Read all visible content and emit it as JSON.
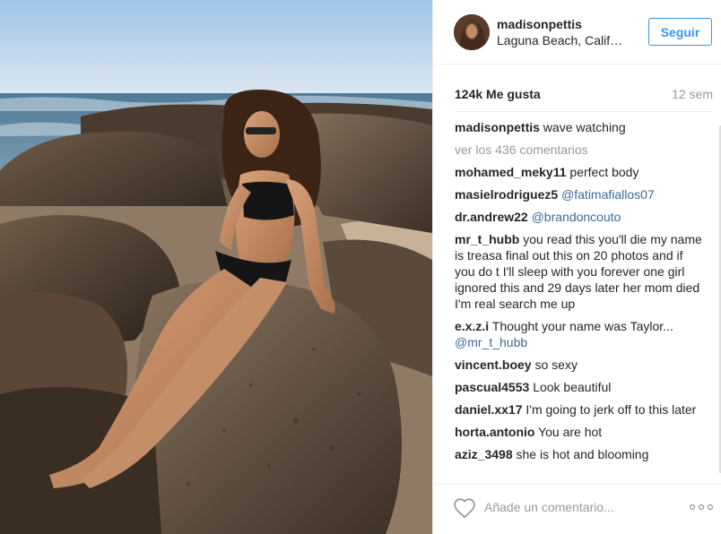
{
  "post": {
    "username": "madisonpettis",
    "location": "Laguna Beach, California",
    "follow_label": "Seguir",
    "likes": "124k Me gusta",
    "time": "12 sem",
    "caption": {
      "user": "madisonpettis",
      "text": "wave watching"
    },
    "view_all": "ver los 436 comentarios",
    "comments": [
      {
        "user": "mohamed_meky11",
        "text": "perfect body",
        "mention": ""
      },
      {
        "user": "masielrodriguez5",
        "text": "",
        "mention": "@fatimafiallos07"
      },
      {
        "user": "dr.andrew22",
        "text": "",
        "mention": "@brandoncouto"
      },
      {
        "user": "mr_t_hubb",
        "text": "you read this you'll die my name is treasa final out this on 20 photos and if you do t I'll sleep with you forever one girl ignored this and 29 days later her mom died I'm real search me up",
        "mention": ""
      },
      {
        "user": "e.x.z.i",
        "text": "Thought your name was Taylor...",
        "mention": "@mr_t_hubb"
      },
      {
        "user": "vincent.boey",
        "text": "so sexy",
        "mention": ""
      },
      {
        "user": "pascual4553",
        "text": "Look beautiful",
        "mention": ""
      },
      {
        "user": "daniel.xx17",
        "text": "I'm going to jerk off to this later",
        "mention": ""
      },
      {
        "user": "horta.antonio",
        "text": "You are hot",
        "mention": ""
      },
      {
        "user": "aziz_3498",
        "text": "she is hot and blooming",
        "mention": ""
      }
    ],
    "comment_placeholder": "Añade un comentario..."
  },
  "icons": {
    "heart": "heart-outline-icon",
    "more": "more-options-icon"
  },
  "colors": {
    "accent": "#3897f0",
    "mention": "#3c6a98",
    "muted": "#999999",
    "text": "#262626"
  }
}
